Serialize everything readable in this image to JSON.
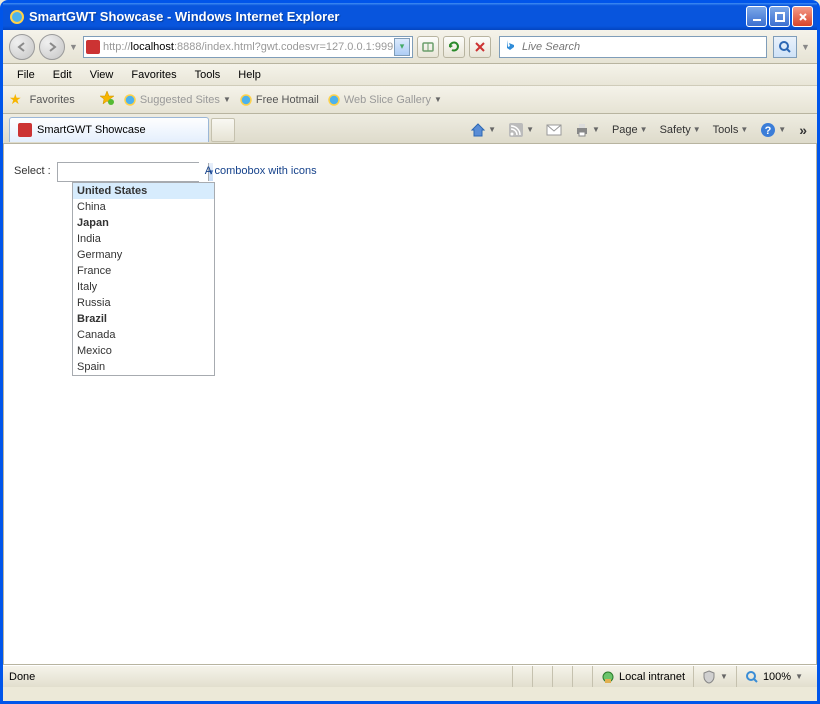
{
  "window": {
    "title": "SmartGWT Showcase - Windows Internet Explorer"
  },
  "address": {
    "prefix": "http://",
    "host": "localhost",
    "rest": ":8888/index.html?gwt.codesvr=127.0.0.1:999"
  },
  "search": {
    "placeholder": "Live Search"
  },
  "menu": {
    "file": "File",
    "edit": "Edit",
    "view": "View",
    "favorites": "Favorites",
    "tools": "Tools",
    "help": "Help"
  },
  "linksbar": {
    "favorites": "Favorites",
    "suggested": "Suggested Sites",
    "hotmail": "Free Hotmail",
    "webslice": "Web Slice Gallery"
  },
  "tab": {
    "title": "SmartGWT Showcase"
  },
  "cmd": {
    "page": "Page",
    "safety": "Safety",
    "tools": "Tools"
  },
  "form": {
    "label": "Select :",
    "desc": "A combobox with icons",
    "value": ""
  },
  "options": [
    {
      "label": "United States",
      "bold": true,
      "selected": true
    },
    {
      "label": "China"
    },
    {
      "label": "Japan",
      "bold": true
    },
    {
      "label": "India"
    },
    {
      "label": "Germany"
    },
    {
      "label": "France"
    },
    {
      "label": "Italy"
    },
    {
      "label": "Russia"
    },
    {
      "label": "Brazil",
      "bold": true
    },
    {
      "label": "Canada"
    },
    {
      "label": "Mexico"
    },
    {
      "label": "Spain"
    }
  ],
  "status": {
    "done": "Done",
    "zone": "Local intranet",
    "zoom": "100%"
  }
}
